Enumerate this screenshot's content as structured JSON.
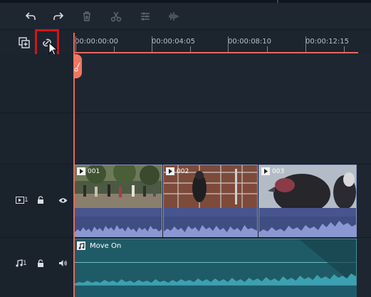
{
  "toolbar": {
    "buttons": [
      {
        "name": "undo",
        "icon": "undo-icon"
      },
      {
        "name": "redo",
        "icon": "redo-icon"
      },
      {
        "name": "delete",
        "icon": "trash-icon"
      },
      {
        "name": "cut",
        "icon": "scissors-icon"
      },
      {
        "name": "adjust",
        "icon": "sliders-icon"
      },
      {
        "name": "audio",
        "icon": "audio-wave-icon"
      }
    ]
  },
  "timeline_header": {
    "add_track_icon": "add-track-icon",
    "link_icon": "link-icon"
  },
  "ruler": {
    "timecodes": [
      "00:00:00:00",
      "00:00:04:05",
      "00:00:08:10",
      "00:00:12:15"
    ]
  },
  "tracks": {
    "video": {
      "number": "1",
      "lock_icon": "lock-icon",
      "visibility_icon": "eye-icon"
    },
    "audio": {
      "number": "1",
      "lock_icon": "lock-icon",
      "volume_icon": "speaker-icon"
    }
  },
  "clips": {
    "video": [
      {
        "label": "001"
      },
      {
        "label": "002"
      },
      {
        "label": "003"
      }
    ],
    "audio": {
      "label": "Move On"
    }
  },
  "colors": {
    "playhead": "#e8685c",
    "highlight": "#d4141b",
    "video_clip": "#3f4d82",
    "audio_clip": "#1f5b66"
  }
}
